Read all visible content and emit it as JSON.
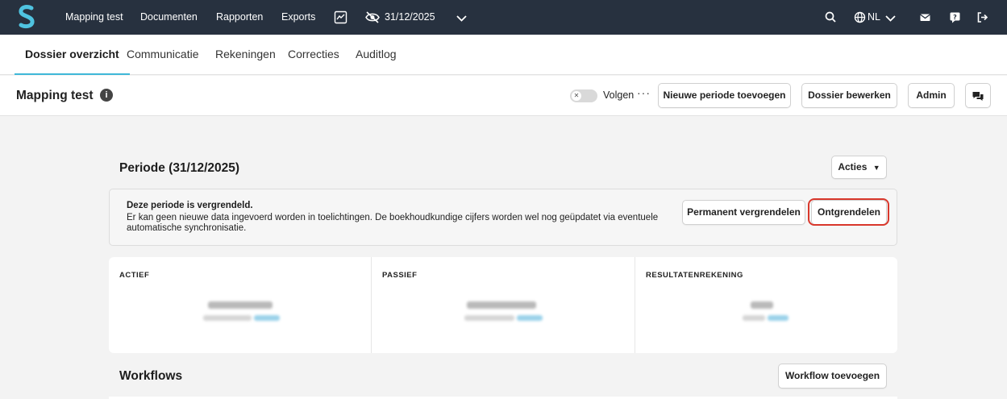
{
  "topbar": {
    "nav_items": [
      "Mapping test",
      "Documenten",
      "Rapporten",
      "Exports"
    ],
    "period": "31/12/2025",
    "language": "NL"
  },
  "tabs": [
    "Dossier overzicht",
    "Communicatie",
    "Rekeningen",
    "Correcties",
    "Auditlog"
  ],
  "titlebar": {
    "title": "Mapping test",
    "follow_label": "Volgen",
    "dots": "···",
    "new_period_button": "Nieuwe periode toevoegen",
    "edit_button": "Dossier bewerken",
    "admin_button": "Admin"
  },
  "period": {
    "title": "Periode (31/12/2025)",
    "actions_button": "Acties"
  },
  "lock_banner": {
    "title": "Deze periode is vergrendeld.",
    "description": "Er kan geen nieuwe data ingevoerd worden in toelichtingen. De boekhoudkundige cijfers worden wel nog geüpdatet via eventuele automatische synchronisatie.",
    "permanent_button": "Permanent vergrendelen",
    "unlock_button": "Ontgrendelen"
  },
  "stats": [
    {
      "label": "ACTIEF"
    },
    {
      "label": "PASSIEF"
    },
    {
      "label": "RESULTATENREKENING"
    }
  ],
  "workflows": {
    "title": "Workflows",
    "add_button": "Workflow toevoegen"
  },
  "colors": {
    "topbar_bg": "#27313f",
    "accent": "#3fb8d8",
    "highlight": "#d9382c"
  }
}
